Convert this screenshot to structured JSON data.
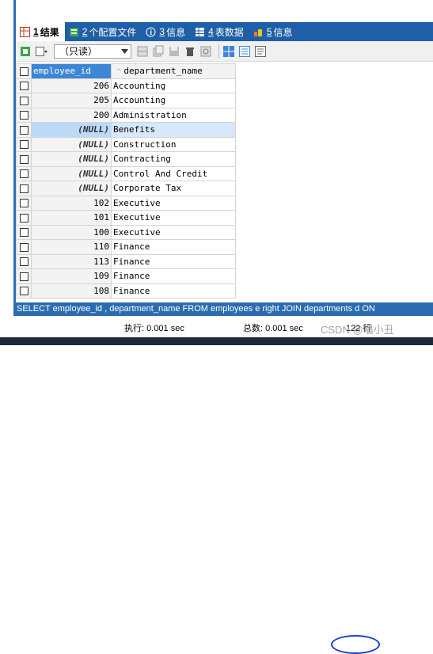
{
  "tabs": [
    {
      "num": "1",
      "label": "结果",
      "icon": "grid-result-icon",
      "active": true
    },
    {
      "num": "2",
      "label": "个配置文件",
      "icon": "profile-icon",
      "active": false
    },
    {
      "num": "3",
      "label": "信息",
      "icon": "info-icon",
      "active": false
    },
    {
      "num": "4",
      "label": "表数据",
      "icon": "table-icon",
      "active": false
    },
    {
      "num": "5",
      "label": "信息",
      "icon": "history-icon",
      "active": false
    }
  ],
  "toolbar": {
    "mode": "（只读）"
  },
  "columns": [
    "employee_id",
    "department_name"
  ],
  "rows": [
    {
      "id": "206",
      "name": "Accounting"
    },
    {
      "id": "205",
      "name": "Accounting"
    },
    {
      "id": "200",
      "name": "Administration"
    },
    {
      "id": "(NULL)",
      "name": "Benefits",
      "selected": true
    },
    {
      "id": "(NULL)",
      "name": "Construction"
    },
    {
      "id": "(NULL)",
      "name": "Contracting"
    },
    {
      "id": "(NULL)",
      "name": "Control And Credit"
    },
    {
      "id": "(NULL)",
      "name": "Corporate Tax"
    },
    {
      "id": "102",
      "name": "Executive"
    },
    {
      "id": "101",
      "name": "Executive"
    },
    {
      "id": "100",
      "name": "Executive"
    },
    {
      "id": "110",
      "name": "Finance"
    },
    {
      "id": "113",
      "name": "Finance"
    },
    {
      "id": "109",
      "name": "Finance"
    },
    {
      "id": "108",
      "name": "Finance"
    }
  ],
  "sql": "SELECT employee_id , department_name FROM employees e right JOIN departments d ON",
  "status": {
    "exec": "执行: 0.001 sec",
    "total": "总数: 0.001 sec",
    "rows": "122 行"
  },
  "watermark": "CSDN @唱小丑",
  "colors": {
    "accent": "#1e5fa8",
    "selected_row": "#d7e8fa",
    "header_selected": "#3d86d6"
  }
}
